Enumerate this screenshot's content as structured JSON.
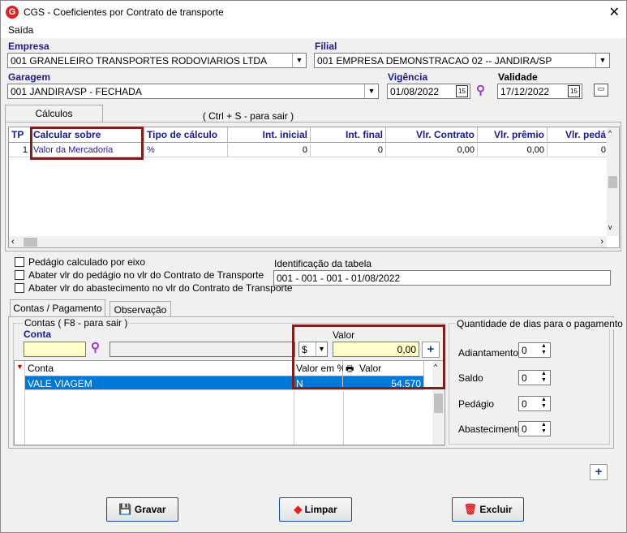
{
  "window": {
    "title": "CGS - Coeficientes por Contrato de transporte",
    "close_glyph": "✕",
    "app_icon_letter": "G"
  },
  "menu": {
    "saida": "Saída"
  },
  "empresa": {
    "label": "Empresa",
    "value": "001 GRANELEIRO TRANSPORTES RODOVIARIOS LTDA"
  },
  "filial": {
    "label": "Filial",
    "value": "001 EMPRESA DEMONSTRACAO 02 -- JANDIRA/SP"
  },
  "garagem": {
    "label": "Garagem",
    "value": "001 JANDIRA/SP - FECHADA"
  },
  "vigencia": {
    "label": "Vigência",
    "value": "01/08/2022"
  },
  "validade": {
    "label": "Validade",
    "value": "17/12/2022"
  },
  "tabs": {
    "calculos": "Cálculos",
    "hint": "( Ctrl + S - para sair )"
  },
  "calc_grid": {
    "headers": [
      "TP",
      "Calcular sobre",
      "Tipo de cálculo",
      "Int. inicial",
      "Int. final",
      "Vlr. Contrato",
      "Vlr. prêmio",
      "Vlr. pedá"
    ],
    "row": [
      "1",
      "Valor da Mercadoria",
      "%",
      "0",
      "0",
      "0,00",
      "0,00",
      "0"
    ]
  },
  "options": {
    "pedagio_eixo": "Pedágio calculado por eixo",
    "abater_pedagio": "Abater vlr do pedágio no vlr do Contrato de Transporte",
    "abater_abastecimento": "Abater vlr do abastecimento no vlr do Contrato de Transporte"
  },
  "identificacao": {
    "label": "Identificação da tabela",
    "value": "001 - 001 - 001 - 01/08/2022"
  },
  "subtabs": {
    "contas": "Contas / Pagamento",
    "observacao": "Observação"
  },
  "contas_group": {
    "title": "Contas ( F8 - para sair )",
    "conta_label": "Conta",
    "valor_label": "Valor",
    "currency": "$",
    "valor_value": "0,00",
    "headers": [
      "Conta",
      "Valor em %",
      "Valor"
    ],
    "rows": [
      {
        "conta": "VALE VIAGEM",
        "pct": "N",
        "valor": "54,570"
      }
    ]
  },
  "dias_group": {
    "title": "Quantidade de dias para o pagamento",
    "items": [
      {
        "label": "Adiantamento",
        "value": "0"
      },
      {
        "label": "Saldo",
        "value": "0"
      },
      {
        "label": "Pedágio",
        "value": "0"
      },
      {
        "label": "Abastecimento",
        "value": "0"
      }
    ]
  },
  "buttons": {
    "gravar": "Gravar",
    "limpar": "Limpar",
    "excluir": "Excluir",
    "plus": "+"
  },
  "colors": {
    "label_blue": "#1a1a8c",
    "highlight_border": "#7b1f1f",
    "selection": "#0078d7"
  }
}
